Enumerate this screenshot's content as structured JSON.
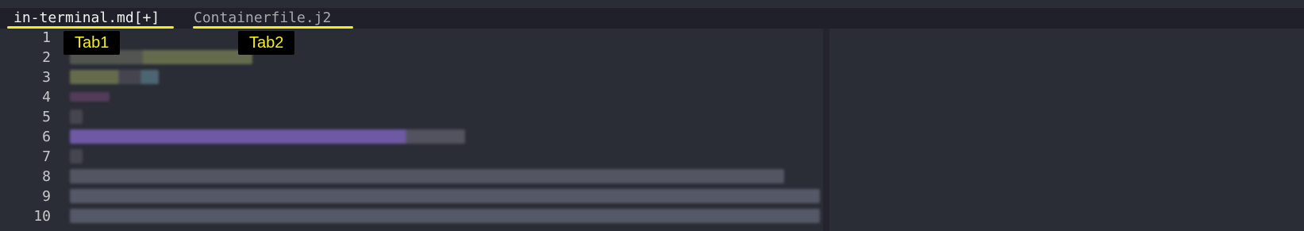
{
  "tabs": [
    {
      "label": "in-terminal.md[+]",
      "active": true
    },
    {
      "label": "Containerfile.j2",
      "active": false
    }
  ],
  "annotations": {
    "tab1": "Tab1",
    "tab2": "Tab2"
  },
  "editor": {
    "line_numbers": [
      "1",
      "2",
      "3",
      "4",
      "5",
      "6",
      "7",
      "8",
      "9",
      "10"
    ],
    "content_note": "redacted"
  },
  "colors": {
    "tab_underline": "#f4ec1e",
    "annotation_bg": "#000000",
    "annotation_text": "#f5f01a",
    "editor_bg": "#2a2c36",
    "tabline_bg": "#1f2029"
  }
}
